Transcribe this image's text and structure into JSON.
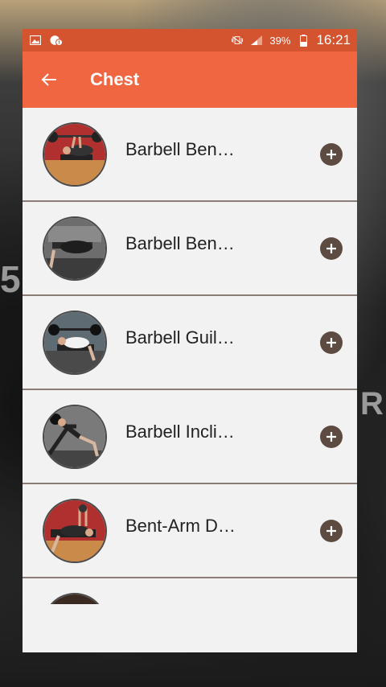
{
  "status_bar": {
    "battery": "39%",
    "time": "16:21"
  },
  "app_bar": {
    "title": "Chest"
  },
  "exercises": [
    {
      "name": "Barbell Ben…"
    },
    {
      "name": "Barbell Ben…"
    },
    {
      "name": "Barbell Guil…"
    },
    {
      "name": "Barbell Incli…"
    },
    {
      "name": "Bent-Arm D…"
    },
    {
      "name": ""
    }
  ],
  "colors": {
    "status_bar": "#d3542f",
    "app_bar": "#ef6640",
    "add_button": "#5d4a40",
    "list_bg": "#f2f2f2"
  },
  "icons": {
    "back": "arrow-left-icon",
    "add": "plus-circle-icon"
  }
}
